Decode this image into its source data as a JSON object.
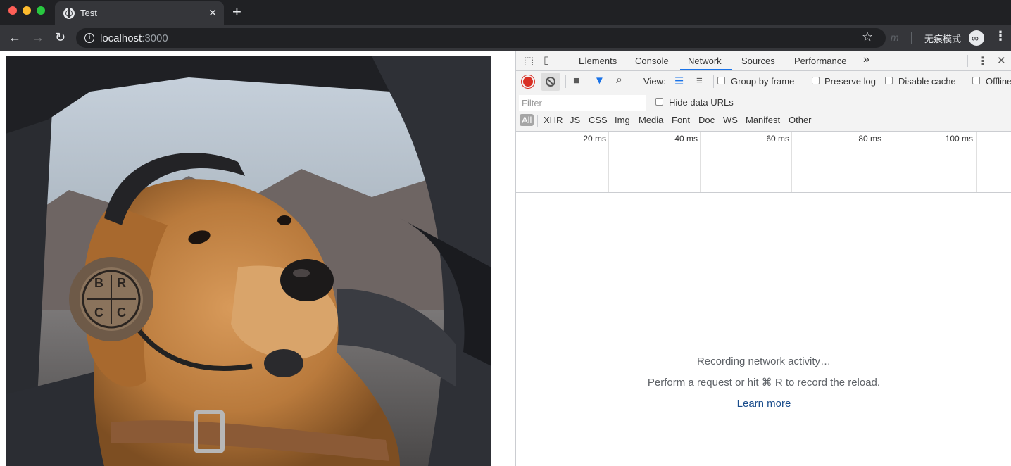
{
  "browser": {
    "tab_title": "Test",
    "tab_close": "✕",
    "new_tab": "+",
    "url_host": "localhost",
    "url_port": ":3000",
    "incognito_label": "无痕模式"
  },
  "devtools": {
    "tabs": [
      "Elements",
      "Console",
      "Network",
      "Sources",
      "Performance"
    ],
    "active_tab": "Network",
    "more_tabs": "»",
    "toolbar": {
      "view_label": "View:",
      "group_by_frame": "Group by frame",
      "preserve_log": "Preserve log",
      "disable_cache": "Disable cache",
      "offline": "Offline"
    },
    "filter": {
      "placeholder": "Filter",
      "hide_data_urls": "Hide data URLs",
      "types": [
        "All",
        "XHR",
        "JS",
        "CSS",
        "Img",
        "Media",
        "Font",
        "Doc",
        "WS",
        "Manifest",
        "Other"
      ],
      "active_type": "All"
    },
    "timeline_ticks": [
      "20 ms",
      "40 ms",
      "60 ms",
      "80 ms",
      "100 ms"
    ],
    "empty_state": {
      "recording": "Recording network activity…",
      "hint": "Perform a request or hit ⌘ R to record the reload.",
      "learn_more": "Learn more"
    }
  },
  "colors": {
    "record": "#d93025",
    "active_tab_underline": "#1a73e8",
    "link": "#1a4d8c"
  }
}
